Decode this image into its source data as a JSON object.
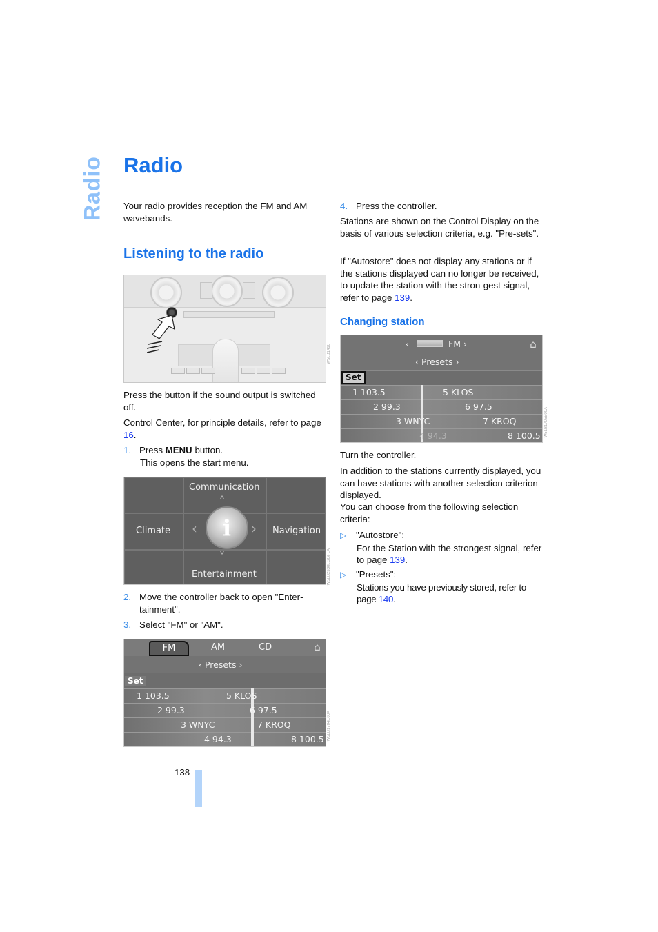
{
  "side_tab": "Radio",
  "title": "Radio",
  "intro": "Your radio provides reception the FM and AM wavebands.",
  "section_listening": {
    "heading": "Listening to the radio",
    "console_image": {
      "alt": "Center console with radio on/off button indicated by arrow",
      "figure_id": "W5LB1410"
    },
    "para1": "Press the button if the sound output is switched off.",
    "para2_prefix": "Control Center, for principle details, refer to page ",
    "para2_link": "16",
    "para2_suffix": ".",
    "steps": [
      {
        "num": "1.",
        "prefix": "Press ",
        "key": "MENU",
        "suffix": " button.",
        "sub": "This opens the start menu."
      },
      {
        "num": "2.",
        "text": "Move the controller back to open \"Enter-tainment\"."
      },
      {
        "num": "3.",
        "text": "Select \"FM\" or \"AM\"."
      },
      {
        "num": "4.",
        "text": "Press the controller."
      }
    ],
    "idrive_menu": {
      "top": "Communication",
      "left": "Climate",
      "right": "Navigation",
      "bottom": "Entertainment",
      "center_icon": "i",
      "figure_id": "W5LB2330LGGFLA"
    },
    "fm_screen": {
      "tabs": [
        "FM",
        "AM",
        "CD"
      ],
      "active_tab": "FM",
      "selection": "Presets",
      "set_label": "Set",
      "stations": [
        {
          "left": "1 103.5",
          "right": "5 KLOS"
        },
        {
          "left": "2 99.3",
          "right": "6 97.5"
        },
        {
          "left": "3 WNYC",
          "right": "7 KROQ"
        },
        {
          "left": "4 94.3",
          "right": "8 100.5"
        }
      ],
      "figure_id": "W5LB1704E00A"
    }
  },
  "right_col": {
    "para_stations": "Stations are shown on the Control Display on the basis of various selection criteria, e.g. \"Pre-sets\".",
    "para_autostore_prefix": "If \"Autostore\" does not display any stations or if the stations displayed can no longer be received, to update the station with the stron-gest signal, refer to page ",
    "para_autostore_link": "139",
    "para_autostore_suffix": "."
  },
  "section_changing": {
    "heading": "Changing station",
    "screen": {
      "band": "FM",
      "selection": "Presets",
      "set_label": "Set",
      "stations": [
        {
          "left": "1 103.5",
          "right": "5 KLOS"
        },
        {
          "left": "2 99.3",
          "right": "6 97.5"
        },
        {
          "left": "3 WNYC",
          "right": "7 KROQ"
        },
        {
          "left": "4 94.3",
          "right": "8 100.5"
        }
      ],
      "figure_id": "W5LB1705E00A"
    },
    "para_turn": "Turn the controller.",
    "para_addition": "In addition to the stations currently displayed, you can have stations with another selection criterion displayed.",
    "para_choose": "You can choose from the following selection criteria:",
    "criteria": [
      {
        "label": "\"Autostore\":",
        "desc_prefix": " For the Station with the strongest signal, refer to page ",
        "link": "139",
        "desc_suffix": "."
      },
      {
        "label": "\"Presets\":",
        "desc_prefix": "Stations you have previously stored, refer to page ",
        "link": "140",
        "desc_suffix": "."
      }
    ]
  },
  "page_number": "138",
  "colors": {
    "heading": "#1a73e8",
    "side_tab": "#8fc1f9",
    "link": "#1a3cf0",
    "page_bar": "#b3d4fa"
  }
}
